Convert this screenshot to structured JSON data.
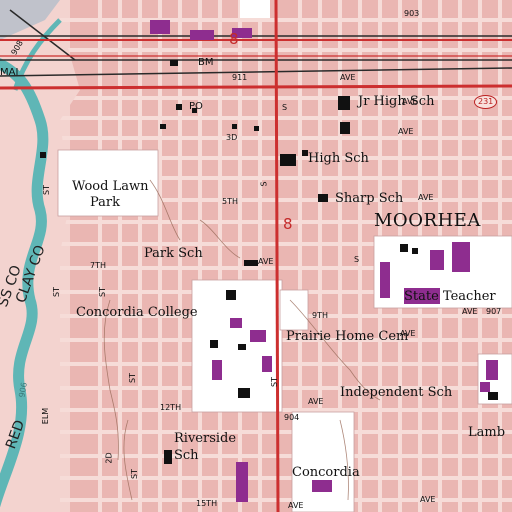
{
  "map": {
    "colors": {
      "urban": "#f3d3cf",
      "block": "#eab6b2",
      "street": "#f6dcd8",
      "highway": "#cc2f2f",
      "river": "#5fb6b6",
      "park": "#ffffff",
      "building": "#8e2d8f",
      "small_building": "#111111",
      "contour": "#9a6b5a",
      "railroad": "#2a2a2a"
    },
    "labels": {
      "jr_high": "Jr High Sch",
      "high_sch": "High Sch",
      "sharp_sch": "Sharp Sch",
      "moorhead": "MOORHEA",
      "wood_lawn": "Wood Lawn",
      "park": "Park",
      "park_sch": "Park Sch",
      "concordia_college": "Concordia College",
      "prairie_home": "Prairie Home Cem",
      "state_teachers": "State Teacher",
      "independent_sch": "Independent Sch",
      "lamb": "Lamb",
      "riverside": "Riverside",
      "sch": "Sch",
      "concordia": "Concordia",
      "po": "PO",
      "bm": "BM",
      "mai": "MAI",
      "clay_co": "CLAY CO",
      "ss_co": "SS CO",
      "red": "RED"
    },
    "streets": {
      "ave_911": "911",
      "ave_top": "AVE",
      "ave_1": "AVE",
      "third": "3D",
      "ave_3": "AVE",
      "fifth": "5TH",
      "ave_5": "AVE",
      "seventh": "7TH",
      "ave_7": "AVE",
      "ninth": "9TH",
      "ave_9": "AVE",
      "ave_907": "907",
      "ave_9r": "AVE",
      "twelfth": "12TH",
      "ave_12": "AVE",
      "ave_904": "904",
      "fifteenth": "15TH",
      "ave_15": "AVE",
      "ave_15r": "AVE",
      "elm": "ELM",
      "st_elm": "ST",
      "st_a": "ST",
      "st_b": "ST",
      "st_c": "ST",
      "st_d": "ST",
      "st_e": "ST",
      "s_first": "S",
      "s_second": "S",
      "s_third": "S",
      "twentieth": "2D",
      "elev_903": "903",
      "elev_906": "906",
      "elev_908": "908"
    },
    "route_numbers": {
      "us_a": "8",
      "us_b": "8",
      "shield": "231"
    }
  }
}
